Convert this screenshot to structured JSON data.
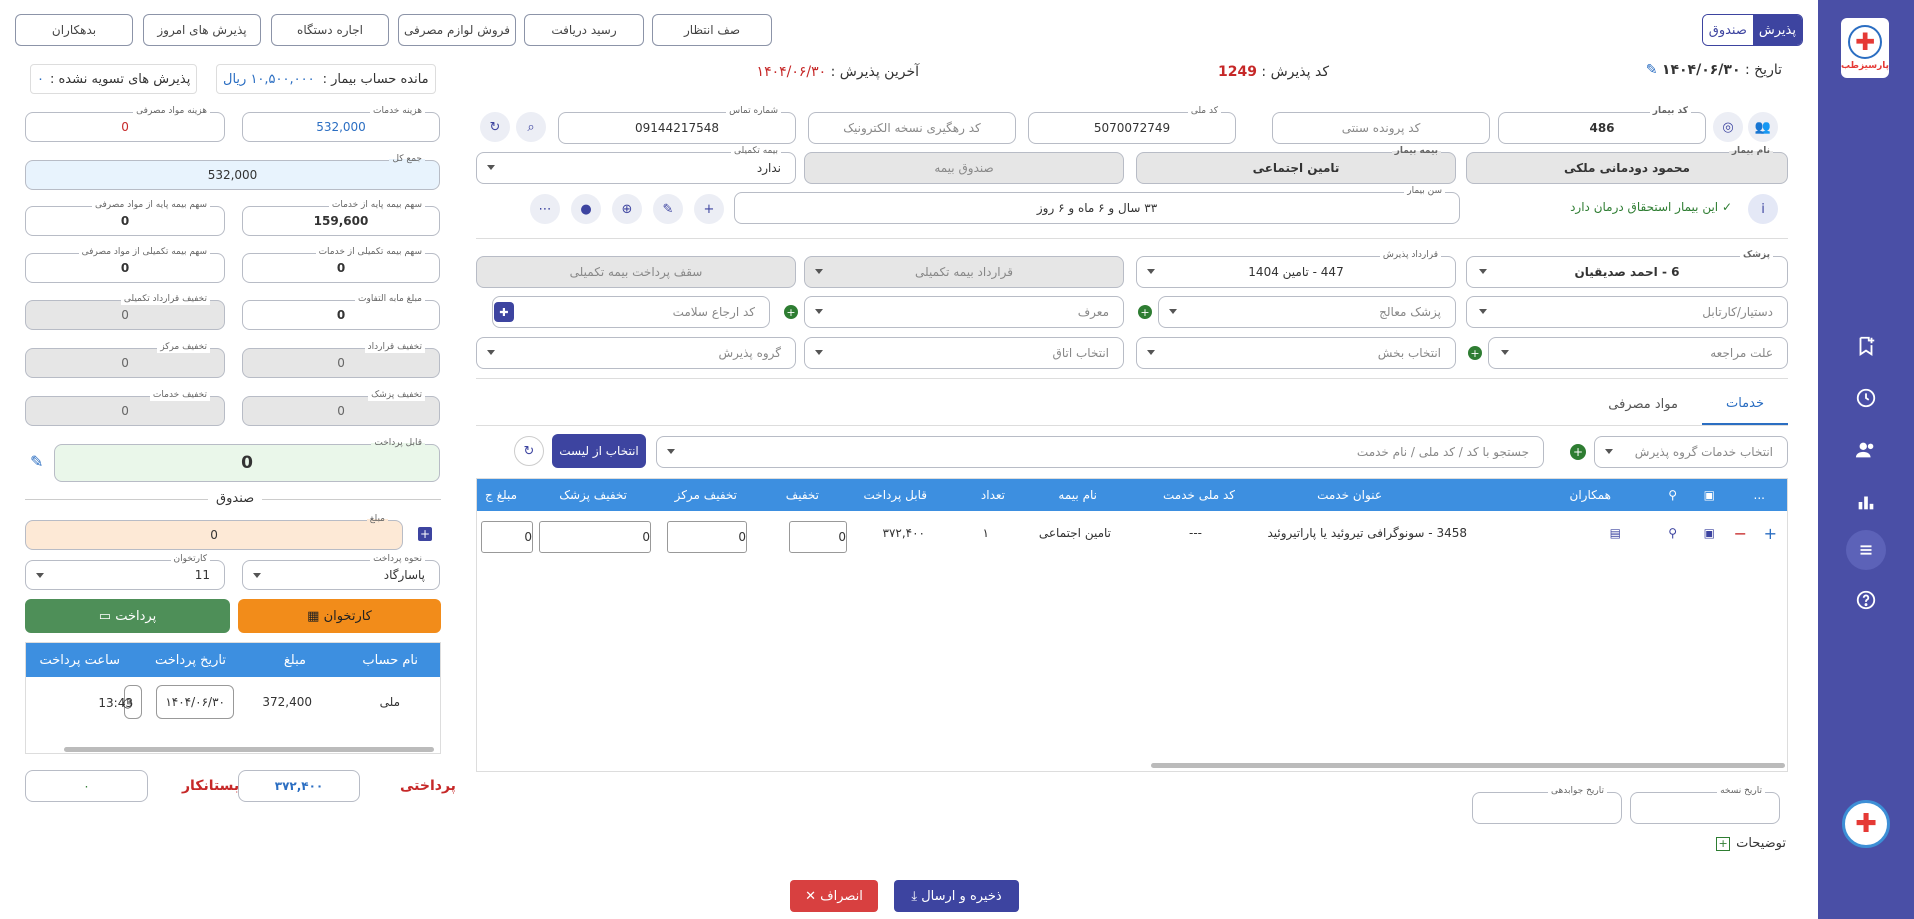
{
  "sidebar": {
    "logo_text": "پارسیزطب"
  },
  "top_buttons": {
    "debtors": "بدهکاران",
    "today_admissions": "پذیرش های امروز",
    "device_rental": "اجاره دستگاه",
    "consumables_sale": "فروش لوازم مصرفی",
    "receipt": "رسید دریافت",
    "queue": "صف انتظار"
  },
  "mode_toggle": {
    "admission": "پذیرش",
    "cashbox": "صندوق"
  },
  "header": {
    "date_label": "تاریخ :",
    "date_value": "۱۴۰۴/۰۶/۳۰",
    "code_label": "کد پذیرش :",
    "code_value": "1249",
    "last_label": "آخرین پذیرش :",
    "last_value": "۱۴۰۴/۰۶/۳۰",
    "balance_label": "مانده حساب بیمار :",
    "balance_value": "۱۰,۵۰۰,۰۰۰ ریال",
    "unsettled_label": "پذیرش های تسویه نشده :",
    "unsettled_value": "۰"
  },
  "patient": {
    "patient_code_label": "کد بیمار",
    "patient_code": "486",
    "traditional_file_ph": "کد پرونده سنتی",
    "national_code_label": "کد ملی",
    "national_code": "5070072749",
    "eprescription_ph": "کد رهگیری نسخه الکترونیک",
    "phone_label": "شماره تماس",
    "phone": "09144217548",
    "name_label": "نام بیمار",
    "name": "محمود دودمانی ملکی",
    "insurance_label": "بیمه بیمار",
    "insurance": "تامین اجتماعی",
    "insurance_box_ph": "صندوق بیمه",
    "supp_label": "بیمه تکمیلی",
    "supp_value": "ندارد",
    "eligibility": "این بیمار استحقاق درمان دارد",
    "age_label": "سن بیمار",
    "age": "۳۳ سال و ۶ ماه و ۶ روز"
  },
  "admission": {
    "doctor_label": "پزشک",
    "doctor": "6 - احمد صدیقیان",
    "contract_label": "قرارداد پذیرش",
    "contract": "447 - تامین 1404",
    "supp_contract_ph": "قرارداد بیمه تکمیلی",
    "supp_ceiling_ph": "سقف پرداخت بیمه تکمیلی",
    "assistant_ph": "دستیار/کارتابل",
    "treating_ph": "پزشک معالج",
    "referrer_ph": "معرف",
    "health_code_ph": "کد ارجاع سلامت",
    "reason_ph": "علت مراجعه",
    "ward_ph": "انتخاب بخش",
    "room_ph": "انتخاب اتاق",
    "group_ph": "گروه پذیرش"
  },
  "tabs": [
    "خدمات",
    "مواد مصرفی"
  ],
  "services": {
    "group_select_ph": "انتخاب خدمات گروه پذیرش",
    "search_ph": "جستجو با کد / کد ملی / نام خدمت",
    "select_list": "انتخاب از لیست",
    "columns": [
      "...",
      "",
      "",
      "همکاران",
      "عنوان خدمت",
      "کد ملی خدمت",
      "نام بیمه",
      "تعداد",
      "قابل پرداخت",
      "تخفیف",
      "تخفیف مرکز",
      "تخفیف پزشک",
      "مبلغ ج"
    ],
    "rows": [
      {
        "title": "3458 - سونوگرافی تیروئید یا پاراتیروئید",
        "national": "---",
        "insurance": "تامین اجتماعی",
        "count": "۱",
        "payable": "۳۷۲,۴۰۰",
        "discount": "0",
        "center_discount": "0",
        "doctor_discount": "0",
        "extra": "0"
      }
    ]
  },
  "notes": {
    "rx_date_label": "تاریخ نسخه",
    "reply_date_label": "تاریخ جوابدهی",
    "desc_label": "توضیحات"
  },
  "costs": {
    "services_cost_label": "هزینه خدمات",
    "services_cost": "532,000",
    "materials_cost_label": "هزینه مواد مصرفی",
    "materials_cost": "0",
    "total_label": "جمع کل",
    "total": "532,000",
    "base_ins_services_label": "سهم بیمه پایه از خدمات",
    "base_ins_services": "159,600",
    "base_ins_materials_label": "سهم بیمه پایه از مواد مصرفی",
    "base_ins_materials": "0",
    "supp_ins_services_label": "سهم بیمه تکمیلی از خدمات",
    "supp_ins_services": "0",
    "supp_ins_materials_label": "سهم بیمه تکمیلی از مواد مصرفی",
    "supp_ins_materials": "0",
    "difference_label": "مبلغ مابه التفاوت",
    "difference": "0",
    "supp_contract_disc_label": "تخفیف قرارداد تکمیلی",
    "supp_contract_disc": "0",
    "contract_disc_label": "تخفیف قرارداد",
    "contract_disc": "0",
    "center_disc_label": "تخفیف مرکز",
    "center_disc": "0",
    "doctor_disc_label": "تخفیف پزشک",
    "doctor_disc": "0",
    "services_disc_label": "تخفیف خدمات",
    "services_disc": "0",
    "payable_label": "قابل پرداخت",
    "payable": "0"
  },
  "cashbox": {
    "title": "صندوق",
    "amount_label": "مبلغ",
    "amount": "0",
    "method_label": "نحوه پرداخت",
    "method": "پاسارگاد",
    "reader_label": "کارتخوان",
    "reader": "11",
    "card_btn": "کارتخوان",
    "pay_btn": "پرداخت",
    "columns": [
      "نام حساب",
      "مبلغ",
      "تاریخ پرداخت",
      "ساعت پرداخت"
    ],
    "rows": [
      {
        "account": "ملی",
        "amount": "372,400",
        "date": "۱۴۰۴/۰۶/۳۰",
        "time": "13:43"
      }
    ],
    "paid_label": "پرداختی",
    "paid": "۳۷۲,۴۰۰",
    "creditor_label": "بستانکار",
    "creditor": "۰"
  },
  "footer": {
    "save": "ذخیره و ارسال",
    "cancel": "انصراف"
  }
}
